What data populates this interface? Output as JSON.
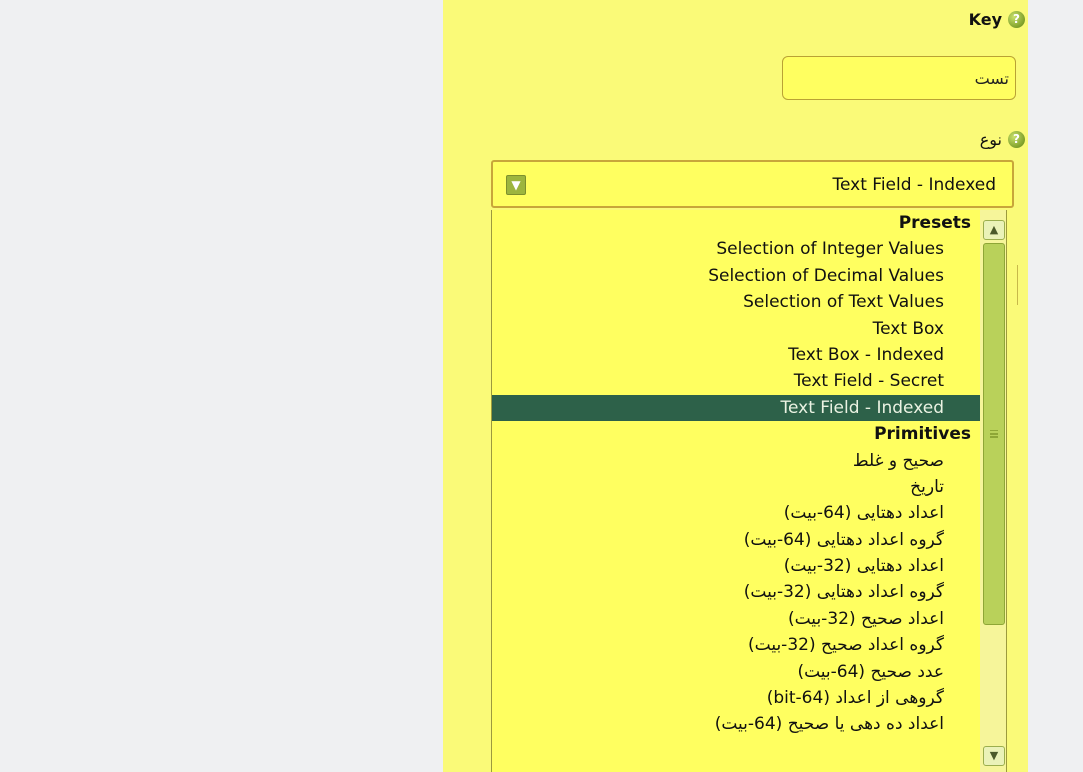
{
  "key_field": {
    "label": "Key",
    "value": "تست"
  },
  "type_field": {
    "label": "نوع",
    "selected": "Text Field - Indexed"
  },
  "dropdown": {
    "groups": [
      {
        "label": "Presets",
        "options": [
          "Selection of Integer Values",
          "Selection of Decimal Values",
          "Selection of Text Values",
          "Text Box",
          "Text Box - Indexed",
          "Text Field - Secret",
          "Text Field - Indexed"
        ]
      },
      {
        "label": "Primitives",
        "options": [
          "صحیح و غلط",
          "تاریخ",
          "اعداد دهتایی (64-بیت)",
          "گروه اعداد دهتایی (64-بیت)",
          "اعداد دهتایی (32-بیت)",
          "گروه اعداد دهتایی (32-بیت)",
          "اعداد صحیح (32-بیت)",
          "گروه اعداد صحیح (32-بیت)",
          "عدد صحیح (64-بیت)",
          "گروهی از اعداد (bit-64)",
          "اعداد ده دهی یا صحیح (64-بیت)"
        ]
      }
    ],
    "selected_index": 6
  },
  "icons": {
    "help": "help-icon",
    "dropdown_arrow": "chevron-down-icon",
    "scroll_up": "chevron-up-icon",
    "scroll_down": "chevron-down-icon"
  },
  "colors": {
    "background": "#eff0f2",
    "panel": "#fafa78",
    "field": "#ffff60",
    "selected_row": "#2d6149"
  }
}
